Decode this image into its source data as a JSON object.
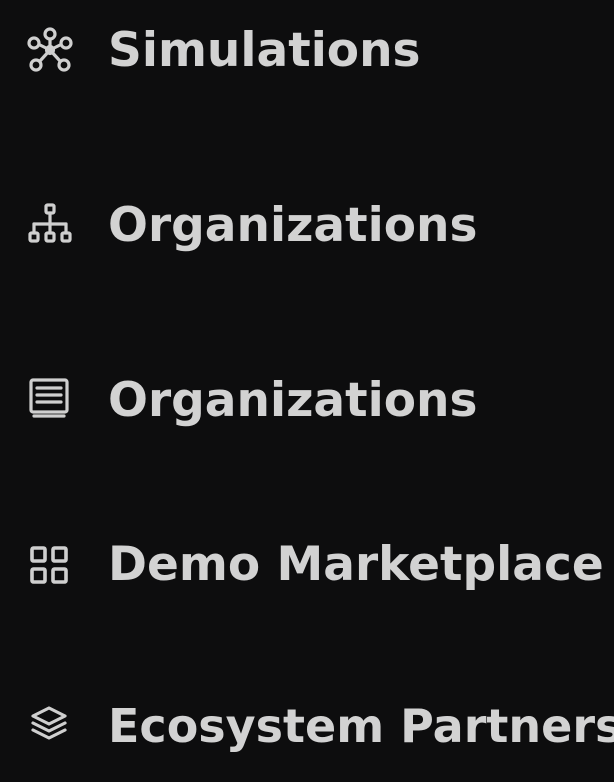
{
  "sidebar": {
    "items": [
      {
        "label": "Simulations",
        "icon": "network-nodes-icon"
      },
      {
        "label": "Organizations",
        "icon": "org-hierarchy-icon"
      },
      {
        "label": "Organizations",
        "icon": "document-list-icon"
      },
      {
        "label": "Demo Marketplace",
        "icon": "grid-apps-icon"
      },
      {
        "label": "Ecosystem Partners",
        "icon": "layers-stack-icon"
      }
    ]
  },
  "colors": {
    "background": "#0d0d0e",
    "text": "#d2d2d2",
    "icon": "#cfcfcf"
  }
}
